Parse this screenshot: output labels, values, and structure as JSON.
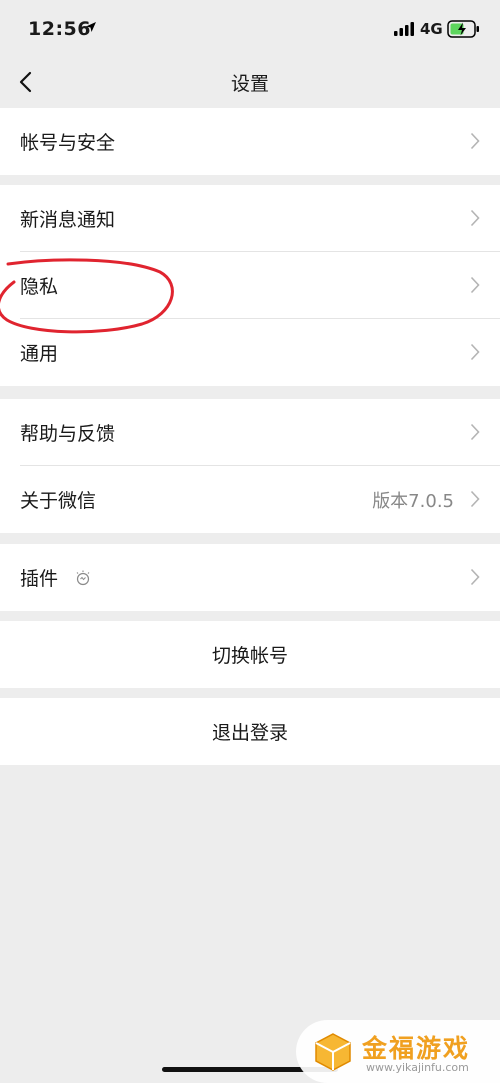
{
  "status_bar": {
    "time": "12:56",
    "network": "4G"
  },
  "nav": {
    "title": "设置"
  },
  "groups": {
    "account": {
      "label": "帐号与安全"
    },
    "notify": {
      "label": "新消息通知"
    },
    "privacy": {
      "label": "隐私"
    },
    "general": {
      "label": "通用"
    },
    "help": {
      "label": "帮助与反馈"
    },
    "about": {
      "label": "关于微信",
      "value": "版本7.0.5"
    },
    "plugins": {
      "label": "插件"
    }
  },
  "actions": {
    "switch_account": "切换帐号",
    "logout": "退出登录"
  },
  "watermark": {
    "name": "金福游戏",
    "url": "www.yikajinfu.com"
  },
  "colors": {
    "background": "#ededed",
    "circle_annotation": "#e0242f",
    "watermark": "#f0a020"
  },
  "icons": [
    "location-arrow-icon",
    "signal-icon",
    "battery-charging-icon",
    "back-chevron-icon",
    "chevron-right-icon",
    "lightbulb-icon"
  ]
}
